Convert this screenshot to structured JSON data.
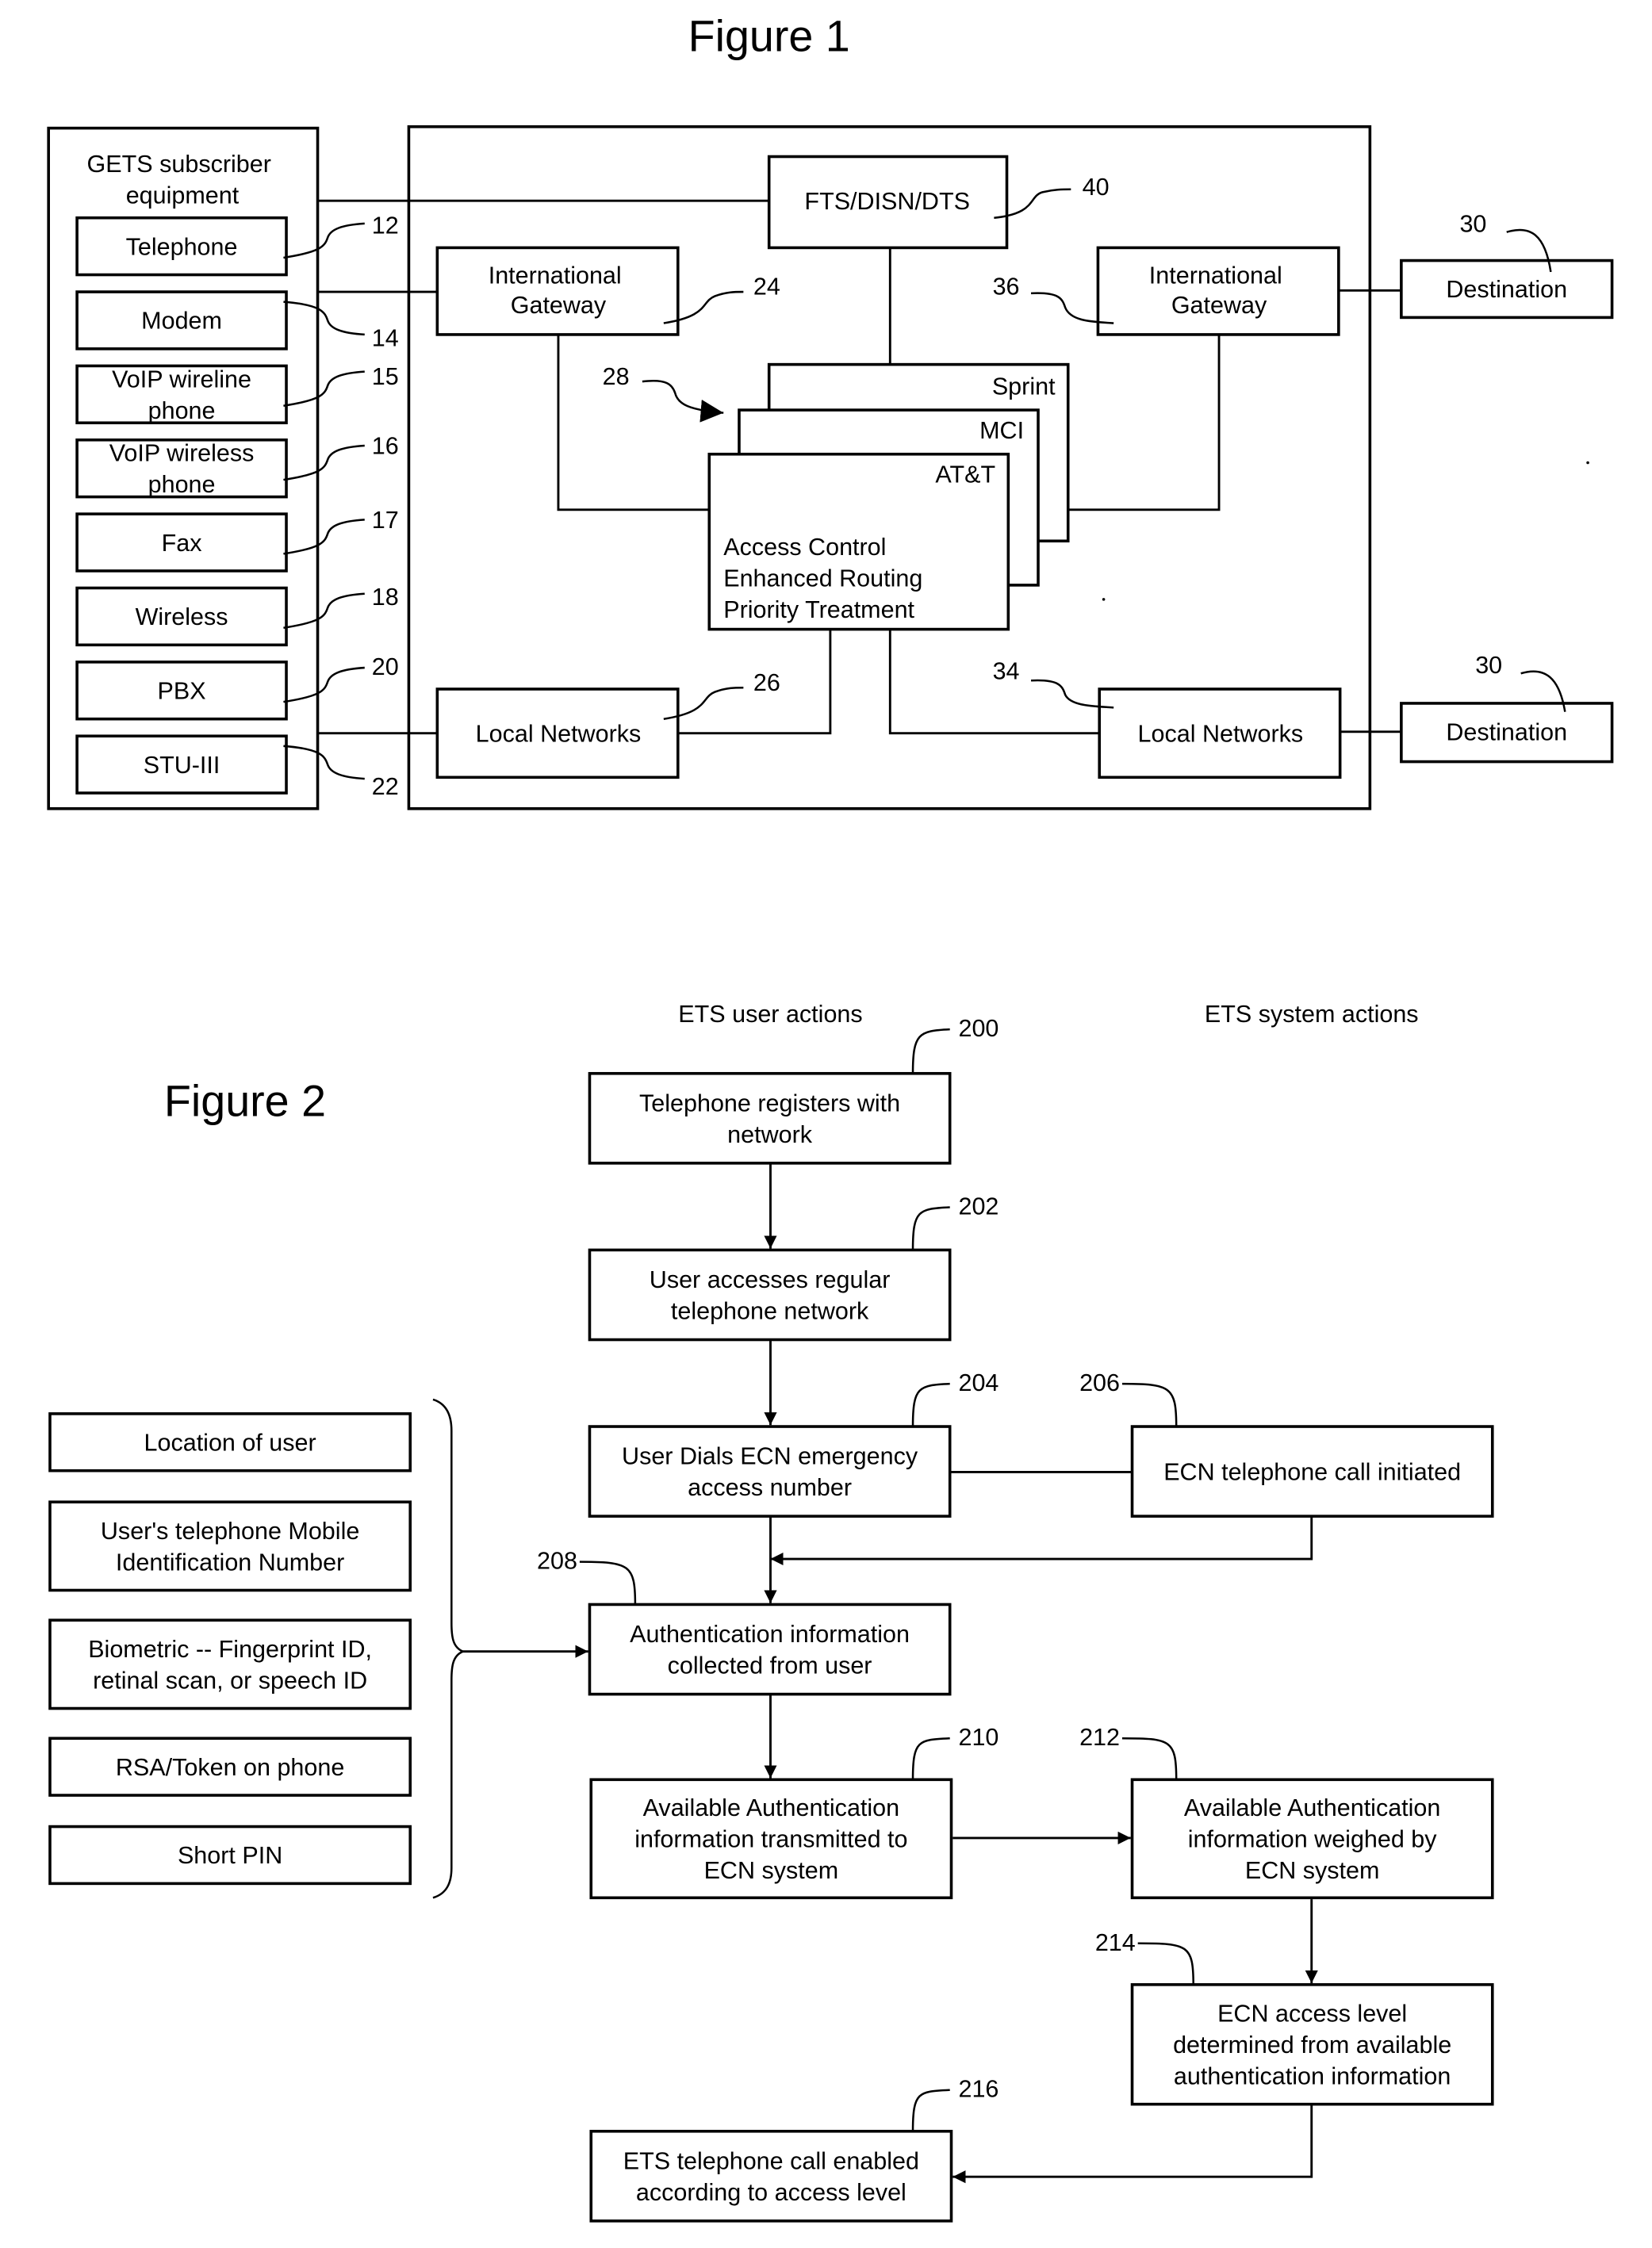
{
  "figure1": {
    "title": "Figure 1",
    "gets_group": {
      "title_lines": [
        "GETS subscriber",
        "equipment"
      ],
      "items": [
        {
          "lines": [
            "Telephone"
          ],
          "ref": "12"
        },
        {
          "lines": [
            "Modem"
          ],
          "ref": "14"
        },
        {
          "lines": [
            "VoIP wireline",
            "phone"
          ],
          "ref": "15"
        },
        {
          "lines": [
            "VoIP wireless",
            "phone"
          ],
          "ref": "16"
        },
        {
          "lines": [
            "Fax"
          ],
          "ref": "17"
        },
        {
          "lines": [
            "Wireless"
          ],
          "ref": "18"
        },
        {
          "lines": [
            "PBX"
          ],
          "ref": "20"
        },
        {
          "lines": [
            "STU-III"
          ],
          "ref": "22"
        }
      ]
    },
    "fts": {
      "label": "FTS/DISN/DTS",
      "ref": "40"
    },
    "intl_gateway_left": {
      "lines": [
        "International",
        "Gateway"
      ],
      "ref": "24"
    },
    "intl_gateway_right": {
      "lines": [
        "International",
        "Gateway"
      ],
      "ref": "36"
    },
    "carriers": {
      "ref": "28",
      "names": [
        "Sprint",
        "MCI",
        "AT&T"
      ],
      "functions": [
        "Access Control",
        "Enhanced Routing",
        "Priority Treatment"
      ]
    },
    "local_networks_left": {
      "label": "Local Networks",
      "ref": "26"
    },
    "local_networks_right": {
      "label": "Local Networks",
      "ref": "34"
    },
    "destination_top": {
      "label": "Destination",
      "ref": "30"
    },
    "destination_bottom": {
      "label": "Destination",
      "ref": "30"
    }
  },
  "figure2": {
    "title": "Figure 2",
    "col_user": "ETS user actions",
    "col_system": "ETS system actions",
    "steps": {
      "s200": {
        "lines": [
          "Telephone registers with",
          "network"
        ],
        "ref": "200"
      },
      "s202": {
        "lines": [
          "User accesses regular",
          "telephone network"
        ],
        "ref": "202"
      },
      "s204": {
        "lines": [
          "User Dials ECN emergency",
          "access number"
        ],
        "ref": "204"
      },
      "s206": {
        "lines": [
          "ECN telephone call initiated"
        ],
        "ref": "206"
      },
      "s208": {
        "lines": [
          "Authentication information",
          "collected from user"
        ],
        "ref": "208"
      },
      "s210": {
        "lines": [
          "Available Authentication",
          "information transmitted to",
          "ECN system"
        ],
        "ref": "210"
      },
      "s212": {
        "lines": [
          "Available Authentication",
          "information weighed by",
          "ECN system"
        ],
        "ref": "212"
      },
      "s214": {
        "lines": [
          "ECN access level",
          "determined from available",
          "authentication information"
        ],
        "ref": "214"
      },
      "s216": {
        "lines": [
          "ETS telephone call enabled",
          "according to access level"
        ],
        "ref": "216"
      }
    },
    "auth_sources": [
      {
        "lines": [
          "Location of user"
        ]
      },
      {
        "lines": [
          "User's telephone Mobile",
          "Identification Number"
        ]
      },
      {
        "lines": [
          "Biometric -- Fingerprint ID,",
          "retinal scan, or speech ID"
        ]
      },
      {
        "lines": [
          "RSA/Token on phone"
        ]
      },
      {
        "lines": [
          "Short PIN"
        ]
      }
    ]
  }
}
